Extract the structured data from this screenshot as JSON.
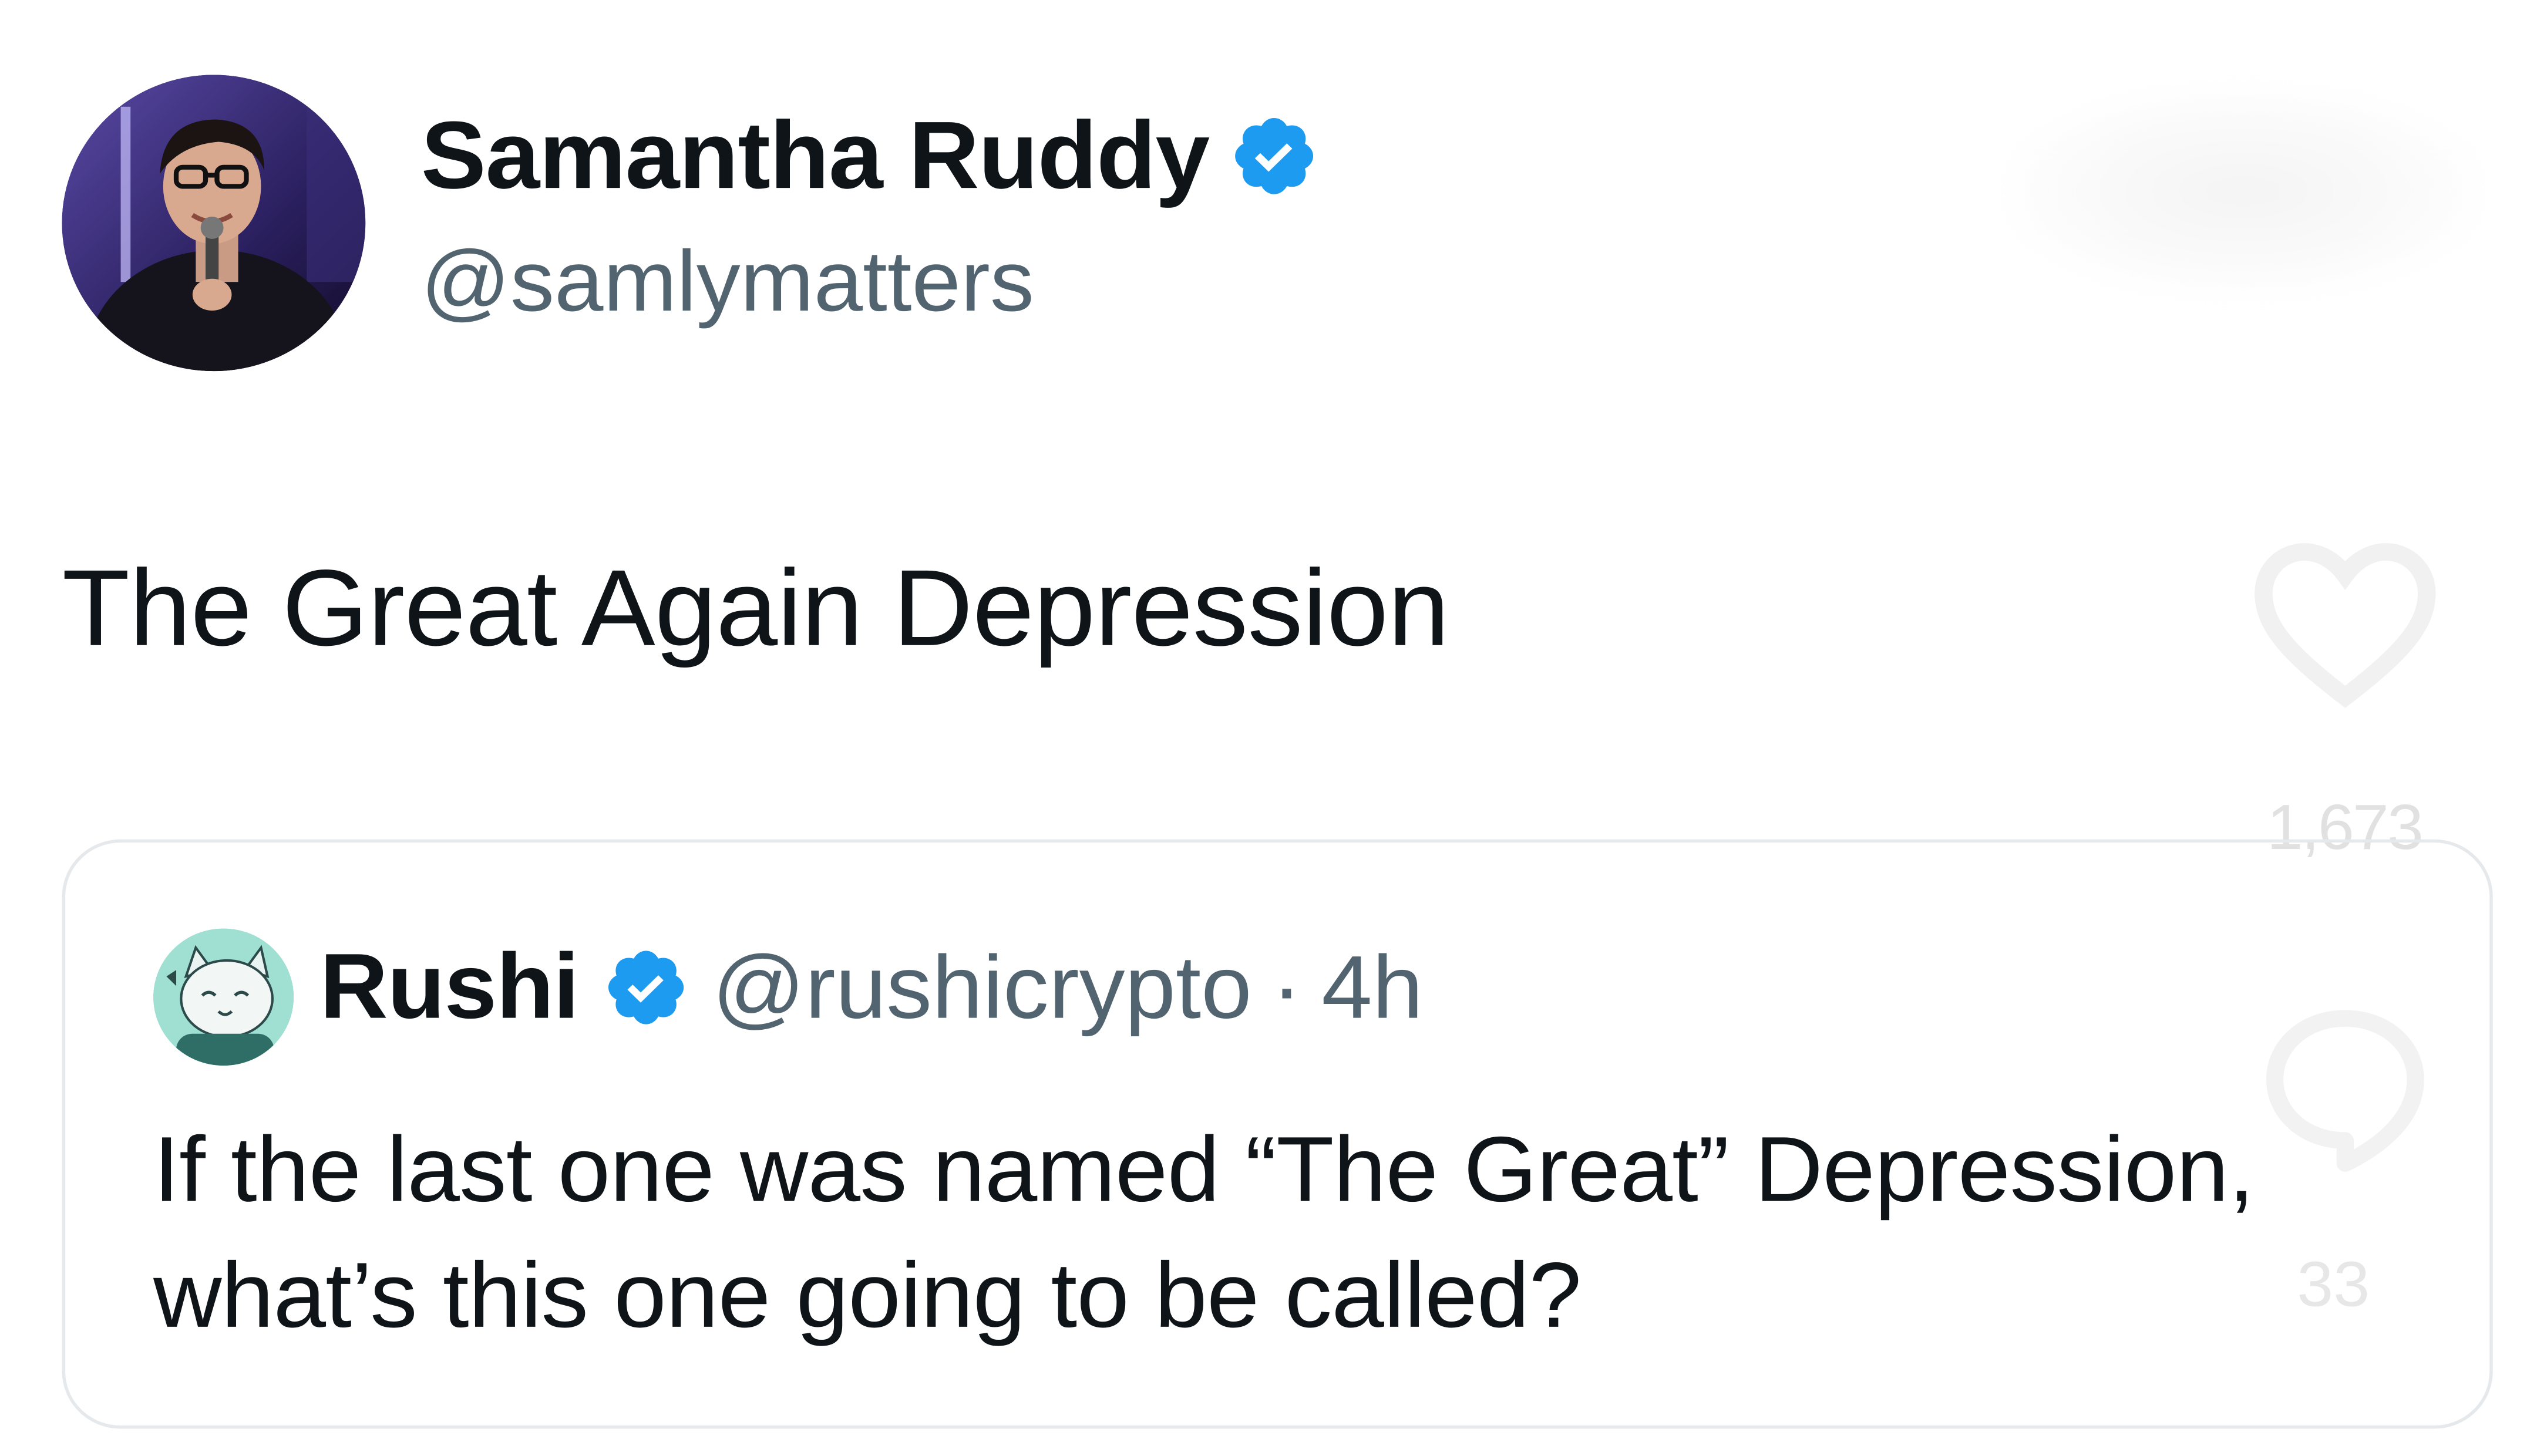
{
  "tweet": {
    "author": {
      "name": "Samantha Ruddy",
      "handle": "@samlymatters",
      "verified": true,
      "avatar_icon": "person-with-microphone-avatar"
    },
    "text": "The Great Again Depression",
    "like_count": "1,673",
    "reply_count": "33"
  },
  "quoted_tweet": {
    "author": {
      "name": "Rushi",
      "handle": "@rushicrypto",
      "verified": true,
      "avatar_icon": "cartoon-cat-avatar"
    },
    "separator": "·",
    "time": "4h",
    "text": "If the last one was named “The Great” Depression, what’s this one going to be called?"
  },
  "colors": {
    "text_primary": "#0f1419",
    "text_secondary": "#536471",
    "verified_blue": "#1d9bf0",
    "card_border": "#e6e9ec"
  }
}
